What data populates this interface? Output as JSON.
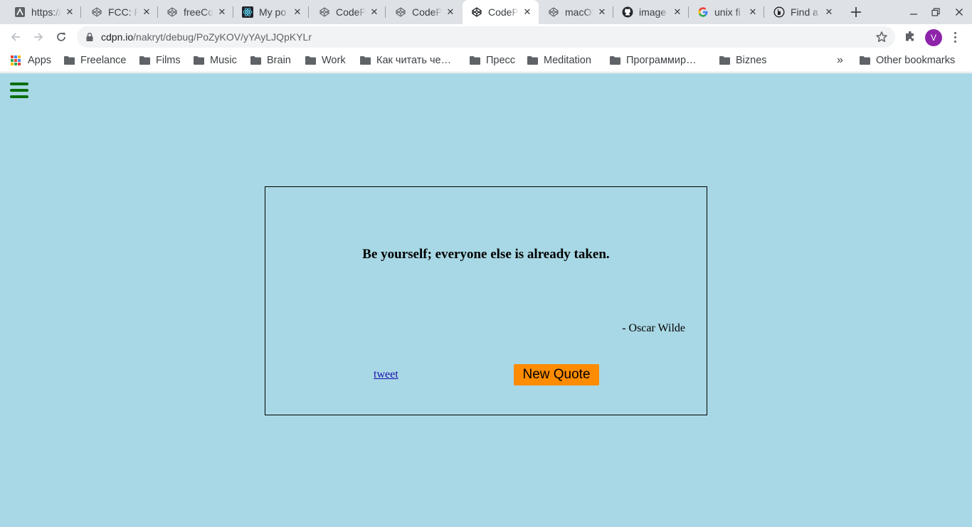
{
  "tabs": [
    {
      "title": "https://",
      "icon": "globe-icon",
      "active": false
    },
    {
      "title": "FCC: P",
      "icon": "codepen-icon",
      "active": false
    },
    {
      "title": "freeCo",
      "icon": "codepen-icon",
      "active": false
    },
    {
      "title": "My po",
      "icon": "react-icon",
      "active": false
    },
    {
      "title": "CodeP",
      "icon": "codepen-icon",
      "active": false
    },
    {
      "title": "CodeP",
      "icon": "codepen-icon",
      "active": false
    },
    {
      "title": "CodeP",
      "icon": "codepen-icon",
      "active": true
    },
    {
      "title": "macOS",
      "icon": "codepen-icon",
      "active": false
    },
    {
      "title": "image",
      "icon": "github-icon",
      "active": false
    },
    {
      "title": "unix fi",
      "icon": "google-icon",
      "active": false
    },
    {
      "title": "Find a",
      "icon": "site-icon",
      "active": false
    }
  ],
  "address_bar": {
    "domain": "cdpn.io",
    "path": "/nakryt/debug/PoZyKOV/yYAyLJQpKYLr"
  },
  "profile": {
    "initial": "V",
    "color": "#8e24aa"
  },
  "bookmarks": {
    "apps_label": "Apps",
    "items": [
      "Freelance",
      "Films",
      "Music",
      "Brain",
      "Work",
      "Как читать че…",
      "Пресс",
      "Meditation",
      "Программир…",
      "Biznes"
    ],
    "overflow": "»",
    "other": "Other bookmarks"
  },
  "page": {
    "background": "#a8d8e5",
    "quote": "Be yourself; everyone else is already taken.",
    "author": "- Oscar Wilde",
    "tweet_label": "tweet",
    "new_quote_label": "New Quote",
    "button_color": "#ff8c00",
    "menu_color": "#0a6e0a"
  }
}
